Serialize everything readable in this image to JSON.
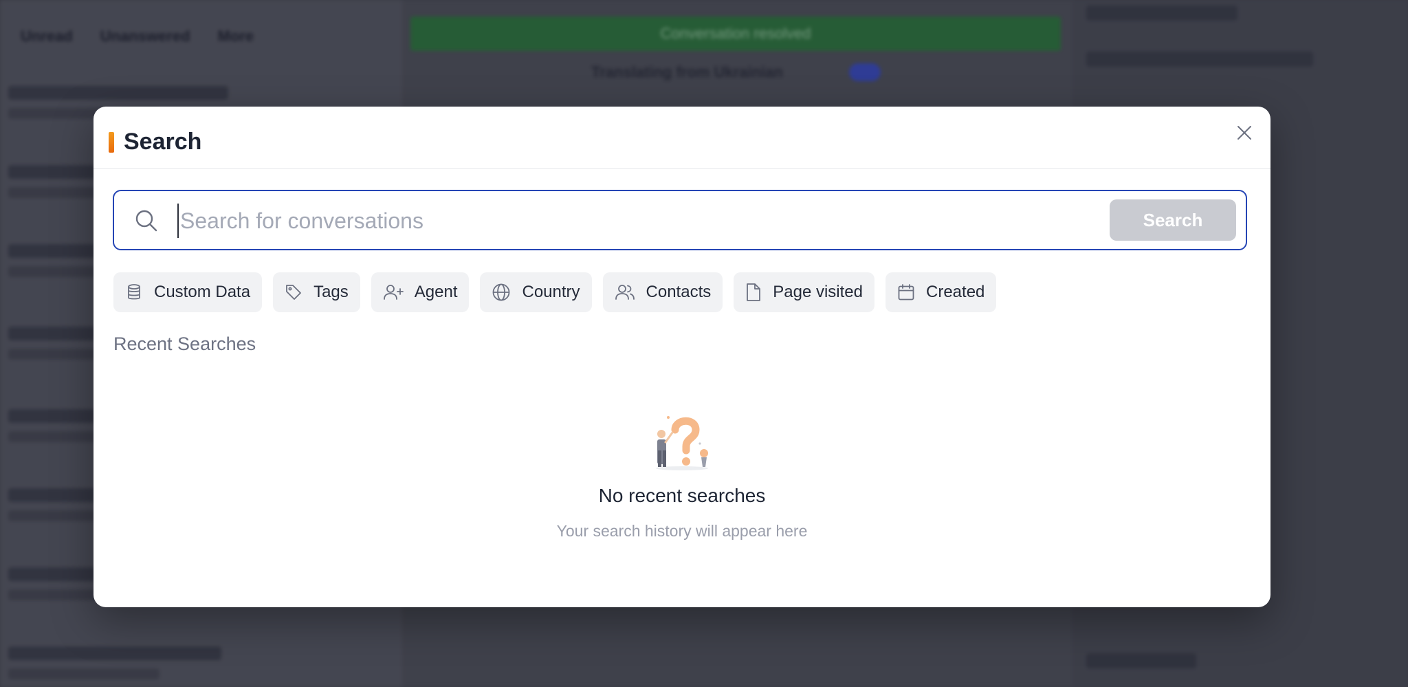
{
  "background": {
    "nav_items": [
      "Unread",
      "Unanswered",
      "More"
    ],
    "banner_text": "Conversation resolved",
    "translate_label": "Translating from Ukrainian"
  },
  "modal": {
    "title": "Search",
    "search": {
      "placeholder": "Search for conversations",
      "value": "",
      "button_label": "Search"
    },
    "filters": [
      {
        "label": "Custom Data",
        "icon": "database-icon"
      },
      {
        "label": "Tags",
        "icon": "tag-icon"
      },
      {
        "label": "Agent",
        "icon": "user-plus-icon"
      },
      {
        "label": "Country",
        "icon": "globe-icon"
      },
      {
        "label": "Contacts",
        "icon": "users-icon"
      },
      {
        "label": "Page visited",
        "icon": "file-icon"
      },
      {
        "label": "Created",
        "icon": "calendar-icon"
      }
    ],
    "recent_label": "Recent Searches",
    "empty_state": {
      "title": "No recent searches",
      "subtitle": "Your search history will appear here"
    }
  },
  "colors": {
    "accent": "#f39a1e",
    "focus_border": "#2545b5",
    "button_disabled": "#c9cbd1"
  }
}
